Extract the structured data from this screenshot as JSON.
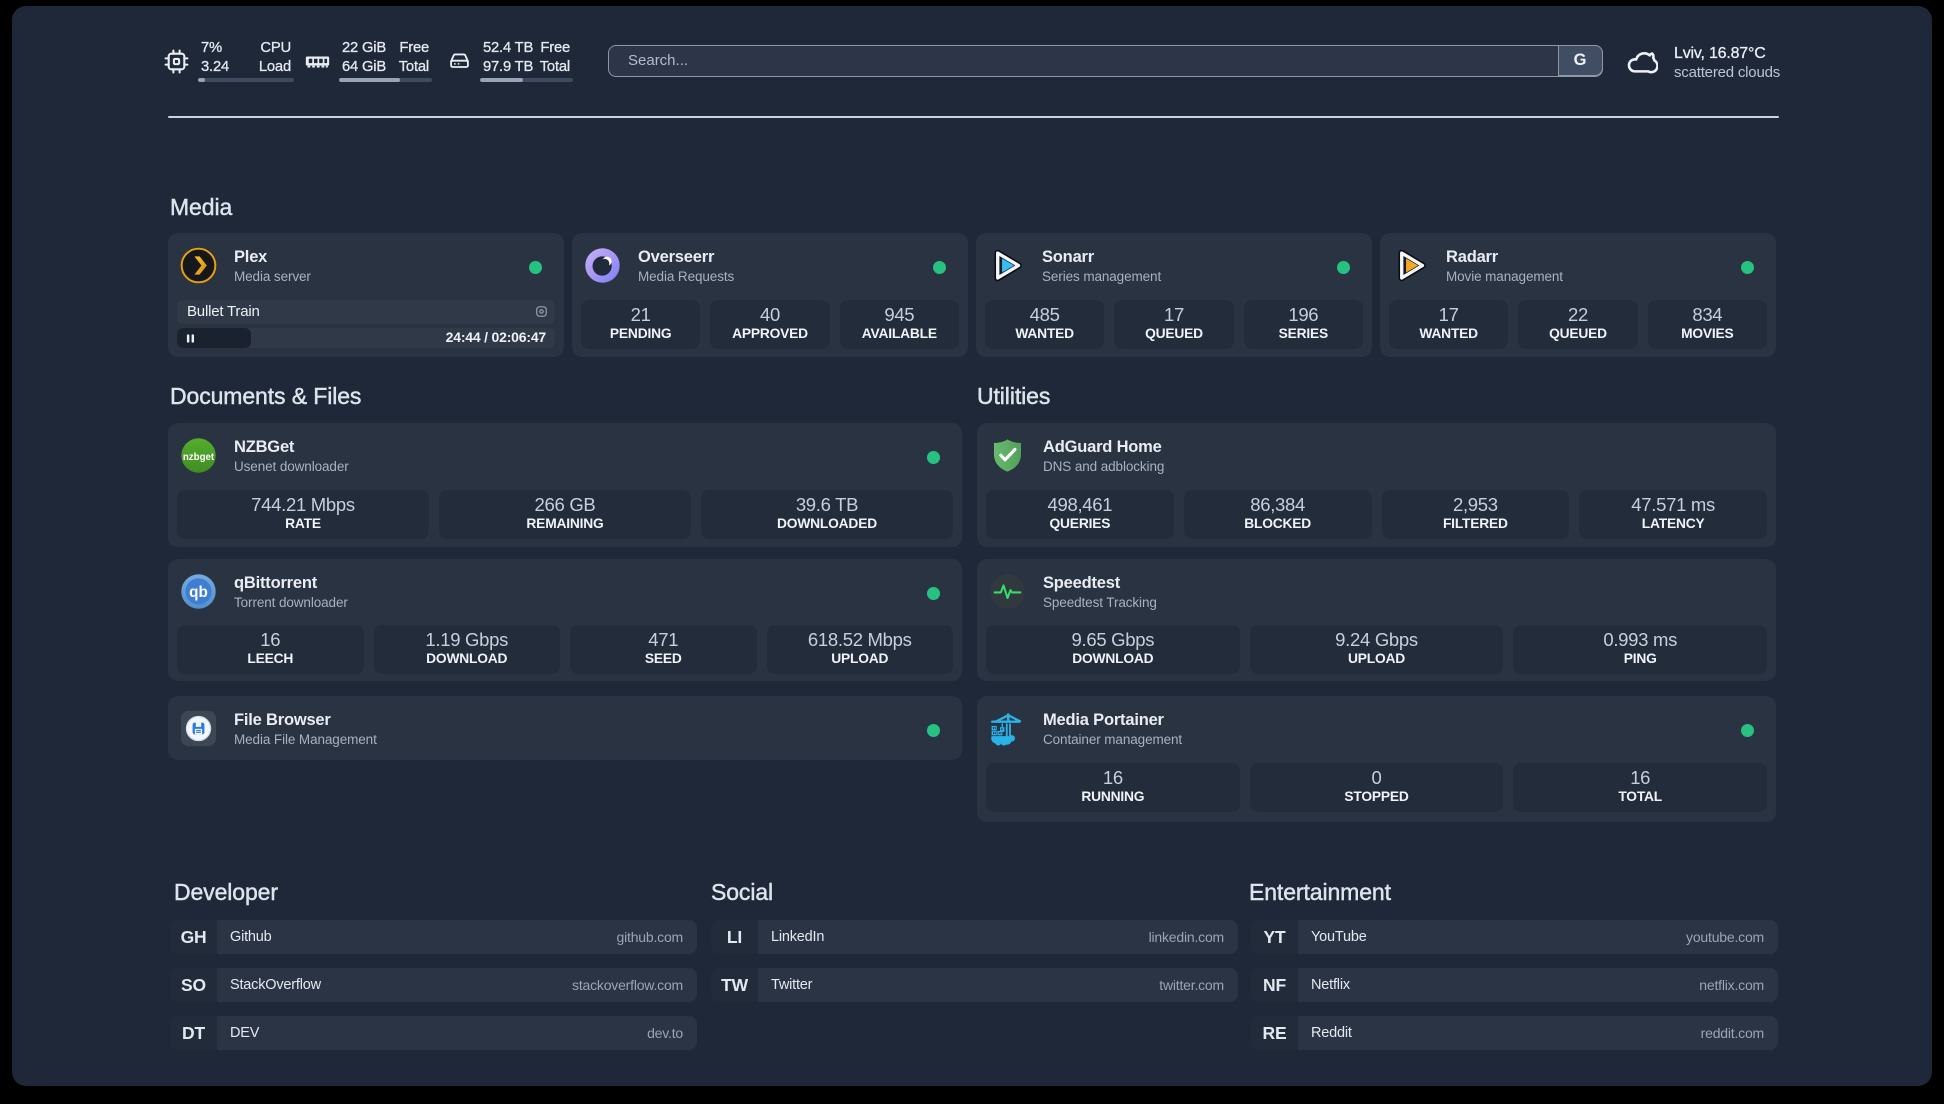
{
  "topbar": {
    "cpu": {
      "icon": "cpu-icon",
      "row1": {
        "value": "7%",
        "label": "CPU"
      },
      "row2": {
        "value": "3.24",
        "label": "Load"
      },
      "progress_percent": 7
    },
    "memory": {
      "icon": "memory-icon",
      "row1": {
        "value": "22 GiB",
        "label": "Free"
      },
      "row2": {
        "value": "64 GiB",
        "label": "Total"
      },
      "progress_percent": 65.6
    },
    "disk": {
      "icon": "hard-drive-icon",
      "row1": {
        "value": "52.4 TB",
        "label": "Free"
      },
      "row2": {
        "value": "97.9 TB",
        "label": "Total"
      },
      "progress_percent": 46.5
    },
    "search": {
      "placeholder": "Search...",
      "provider_button": "G"
    },
    "weather": {
      "icon": "cloud-icon",
      "location_temp": "Lviv, 16.87°C",
      "condition": "scattered clouds"
    }
  },
  "sections": {
    "media": {
      "title": "Media",
      "cards": {
        "plex": {
          "icon": "plex-logo",
          "name": "Plex",
          "description": "Media server",
          "status": "online",
          "player": {
            "title": "Bullet Train",
            "state": "paused",
            "time_display": "24:44 / 02:06:47",
            "progress_percent": 19.5
          }
        },
        "overseerr": {
          "icon": "overseerr-logo",
          "name": "Overseerr",
          "description": "Media Requests",
          "status": "online",
          "stats": [
            {
              "value": "21",
              "label": "PENDING"
            },
            {
              "value": "40",
              "label": "APPROVED"
            },
            {
              "value": "945",
              "label": "AVAILABLE"
            }
          ]
        },
        "sonarr": {
          "icon": "sonarr-logo",
          "name": "Sonarr",
          "description": "Series management",
          "status": "online",
          "stats": [
            {
              "value": "485",
              "label": "WANTED"
            },
            {
              "value": "17",
              "label": "QUEUED"
            },
            {
              "value": "196",
              "label": "SERIES"
            }
          ]
        },
        "radarr": {
          "icon": "radarr-logo",
          "name": "Radarr",
          "description": "Movie management",
          "status": "online",
          "stats": [
            {
              "value": "17",
              "label": "WANTED"
            },
            {
              "value": "22",
              "label": "QUEUED"
            },
            {
              "value": "834",
              "label": "MOVIES"
            }
          ]
        }
      }
    },
    "documents": {
      "title": "Documents & Files",
      "cards": {
        "nzbget": {
          "icon": "nzbget-logo",
          "name": "NZBGet",
          "description": "Usenet downloader",
          "status": "online",
          "stats": [
            {
              "value": "744.21 Mbps",
              "label": "RATE"
            },
            {
              "value": "266 GB",
              "label": "REMAINING"
            },
            {
              "value": "39.6 TB",
              "label": "DOWNLOADED"
            }
          ]
        },
        "qbittorrent": {
          "icon": "qbittorrent-logo",
          "name": "qBittorrent",
          "description": "Torrent downloader",
          "status": "online",
          "stats": [
            {
              "value": "16",
              "label": "LEECH"
            },
            {
              "value": "1.19 Gbps",
              "label": "DOWNLOAD"
            },
            {
              "value": "471",
              "label": "SEED"
            },
            {
              "value": "618.52 Mbps",
              "label": "UPLOAD"
            }
          ]
        },
        "filebrowser": {
          "icon": "filebrowser-logo",
          "name": "File Browser",
          "description": "Media File Management",
          "status": "online",
          "stats": []
        }
      }
    },
    "utilities": {
      "title": "Utilities",
      "cards": {
        "adguard": {
          "icon": "adguard-logo",
          "name": "AdGuard Home",
          "description": "DNS and adblocking",
          "status": "none",
          "stats": [
            {
              "value": "498,461",
              "label": "QUERIES"
            },
            {
              "value": "86,384",
              "label": "BLOCKED"
            },
            {
              "value": "2,953",
              "label": "FILTERED"
            },
            {
              "value": "47.571 ms",
              "label": "LATENCY"
            }
          ]
        },
        "speedtest": {
          "icon": "speedtest-logo",
          "name": "Speedtest",
          "description": "Speedtest Tracking",
          "status": "none",
          "stats": [
            {
              "value": "9.65 Gbps",
              "label": "DOWNLOAD"
            },
            {
              "value": "9.24 Gbps",
              "label": "UPLOAD"
            },
            {
              "value": "0.993 ms",
              "label": "PING"
            }
          ]
        },
        "portainer": {
          "icon": "portainer-logo",
          "name": "Media Portainer",
          "description": "Container management",
          "status": "online",
          "stats": [
            {
              "value": "16",
              "label": "RUNNING"
            },
            {
              "value": "0",
              "label": "STOPPED"
            },
            {
              "value": "16",
              "label": "TOTAL"
            }
          ]
        }
      }
    }
  },
  "bookmarks": {
    "developer": {
      "title": "Developer",
      "items": [
        {
          "abbr": "GH",
          "name": "Github",
          "url": "github.com"
        },
        {
          "abbr": "SO",
          "name": "StackOverflow",
          "url": "stackoverflow.com"
        },
        {
          "abbr": "DT",
          "name": "DEV",
          "url": "dev.to"
        }
      ]
    },
    "social": {
      "title": "Social",
      "items": [
        {
          "abbr": "LI",
          "name": "LinkedIn",
          "url": "linkedin.com"
        },
        {
          "abbr": "TW",
          "name": "Twitter",
          "url": "twitter.com"
        }
      ]
    },
    "entertainment": {
      "title": "Entertainment",
      "items": [
        {
          "abbr": "YT",
          "name": "YouTube",
          "url": "youtube.com"
        },
        {
          "abbr": "NF",
          "name": "Netflix",
          "url": "netflix.com"
        },
        {
          "abbr": "RE",
          "name": "Reddit",
          "url": "reddit.com"
        }
      ]
    }
  }
}
